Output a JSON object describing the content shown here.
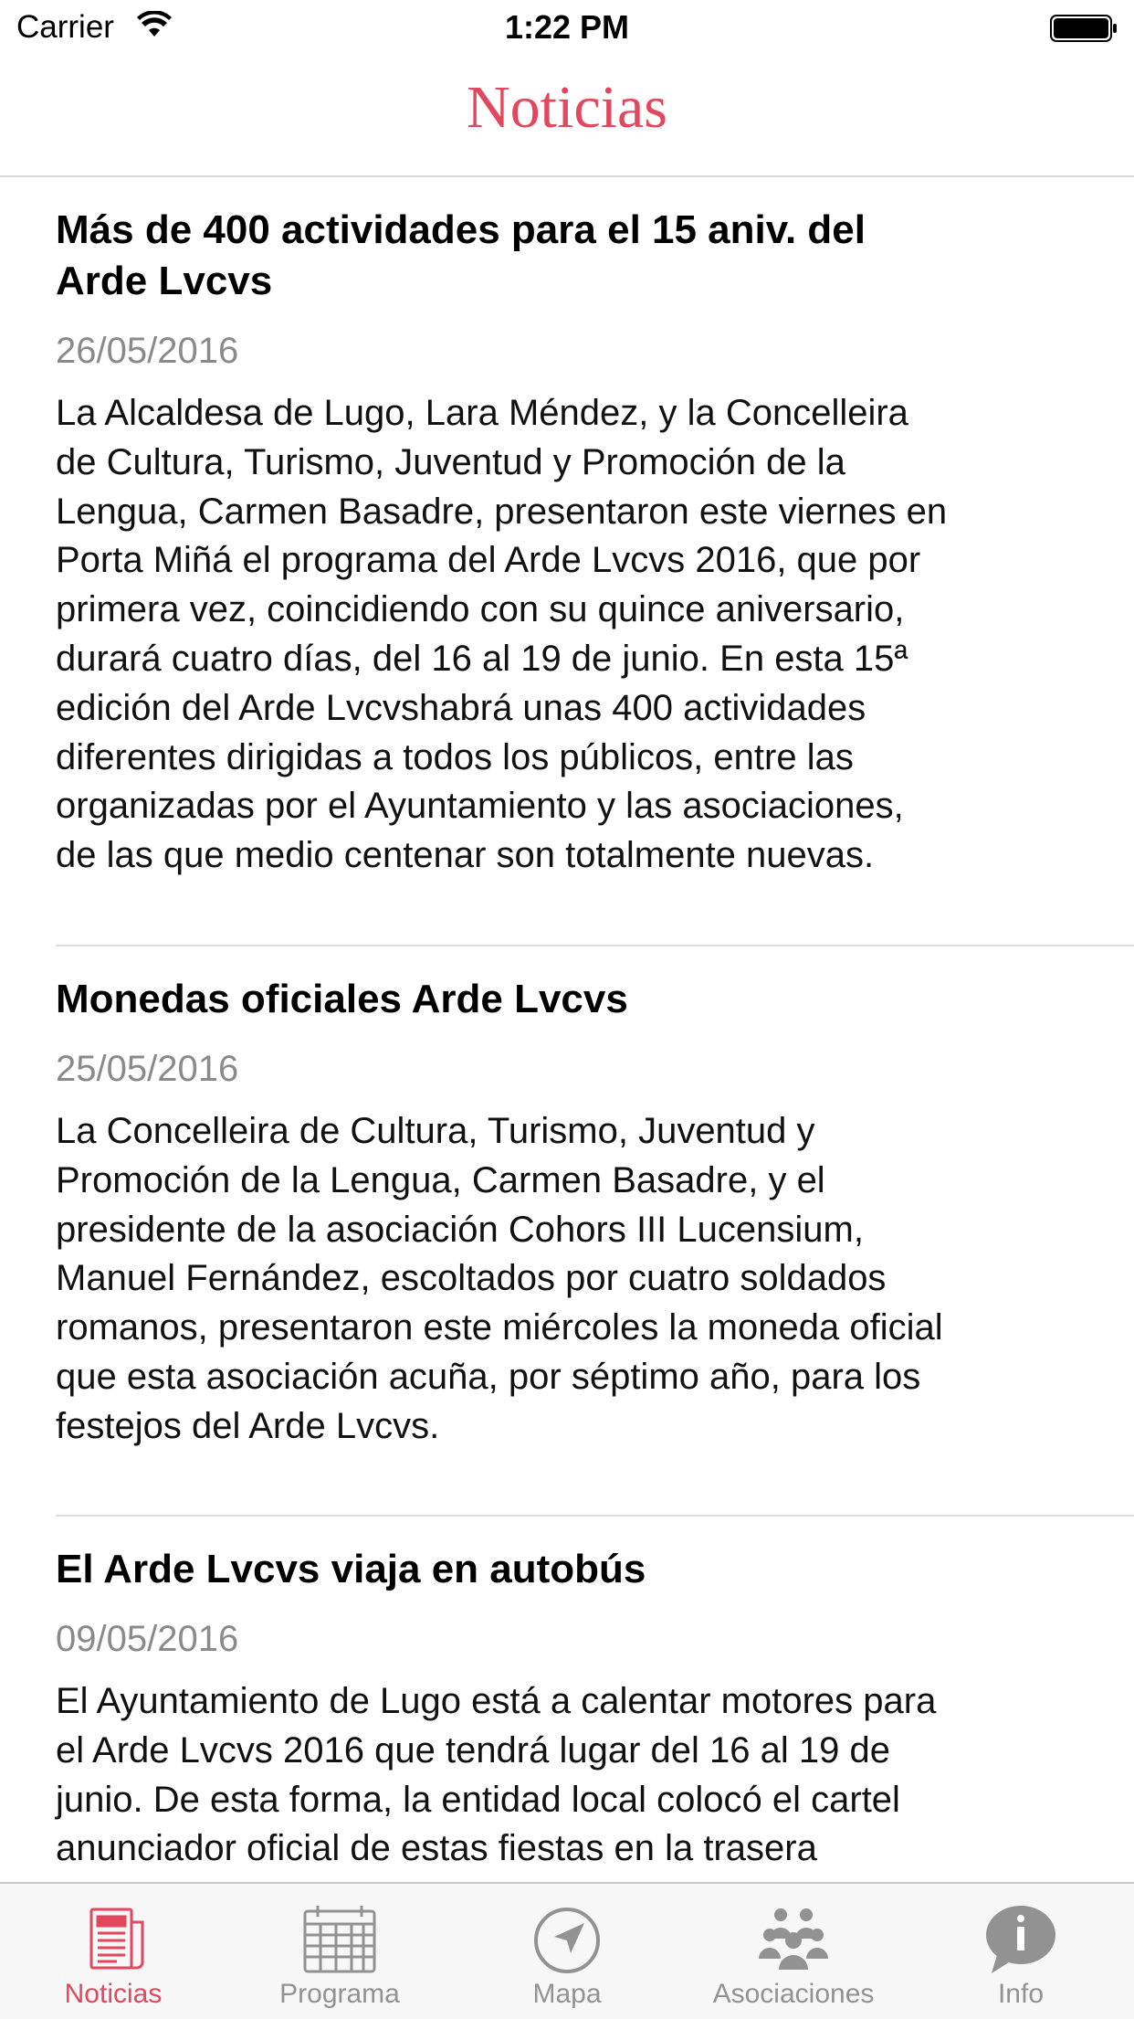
{
  "status_bar": {
    "carrier": "Carrier",
    "time": "1:22 PM"
  },
  "nav": {
    "title": "Noticias"
  },
  "articles": [
    {
      "title_line1": "Más de 400 actividades para  el 15 aniv. del",
      "title_line2": "Arde Lvcvs",
      "date": "26/05/2016",
      "lines": [
        "La Alcaldesa de Lugo, Lara Méndez, y la Concelleira",
        "de Cultura, Turismo, Juventud y Promoción de la",
        "Lengua, Carmen Basadre, presentaron este viernes en",
        "Porta Miñá el programa del Arde Lvcvs 2016, que por",
        "primera vez, coincidiendo con su quince aniversario,",
        "durará cuatro días, del 16 al 19 de junio. En esta 15ª",
        "edición del Arde Lvcvshabrá unas 400 actividades",
        "diferentes dirigidas a todos los públicos, entre las",
        "organizadas por el Ayuntamiento y las asociaciones,",
        "de las que medio centenar son totalmente nuevas."
      ]
    },
    {
      "title_line1": "Monedas oficiales Arde Lvcvs",
      "date": "25/05/2016",
      "lines": [
        "La Concelleira de Cultura, Turismo, Juventud y",
        "Promoción de la Lengua, Carmen Basadre, y el",
        "presidente de la asociación Cohors III Lucensium,",
        "Manuel Fernández, escoltados por cuatro soldados",
        "romanos, presentaron este miércoles la moneda oficial",
        "que esta asociación acuña, por séptimo año, para los",
        "festejos del Arde Lvcvs."
      ]
    },
    {
      "title_line1": "El Arde Lvcvs viaja en autobús",
      "date": "09/05/2016",
      "lines": [
        "El Ayuntamiento de Lugo está a calentar motores para",
        "el Arde Lvcvs 2016 que tendrá lugar del 16 al 19 de",
        "junio. De esta forma, la entidad local colocó el cartel",
        "anunciador oficial de estas fiestas en la trasera"
      ]
    }
  ],
  "tabs": [
    {
      "label": "Noticias",
      "icon": "newspaper-icon",
      "active": true
    },
    {
      "label": "Programa",
      "icon": "calendar-icon",
      "active": false
    },
    {
      "label": "Mapa",
      "icon": "compass-arrow-icon",
      "active": false
    },
    {
      "label": "Asociaciones",
      "icon": "people-group-icon",
      "active": false
    },
    {
      "label": "Info",
      "icon": "info-bubble-icon",
      "active": false
    }
  ],
  "colors": {
    "accent": "#e2475d",
    "inactive": "#929292",
    "date_gray": "#8a8a8a"
  }
}
